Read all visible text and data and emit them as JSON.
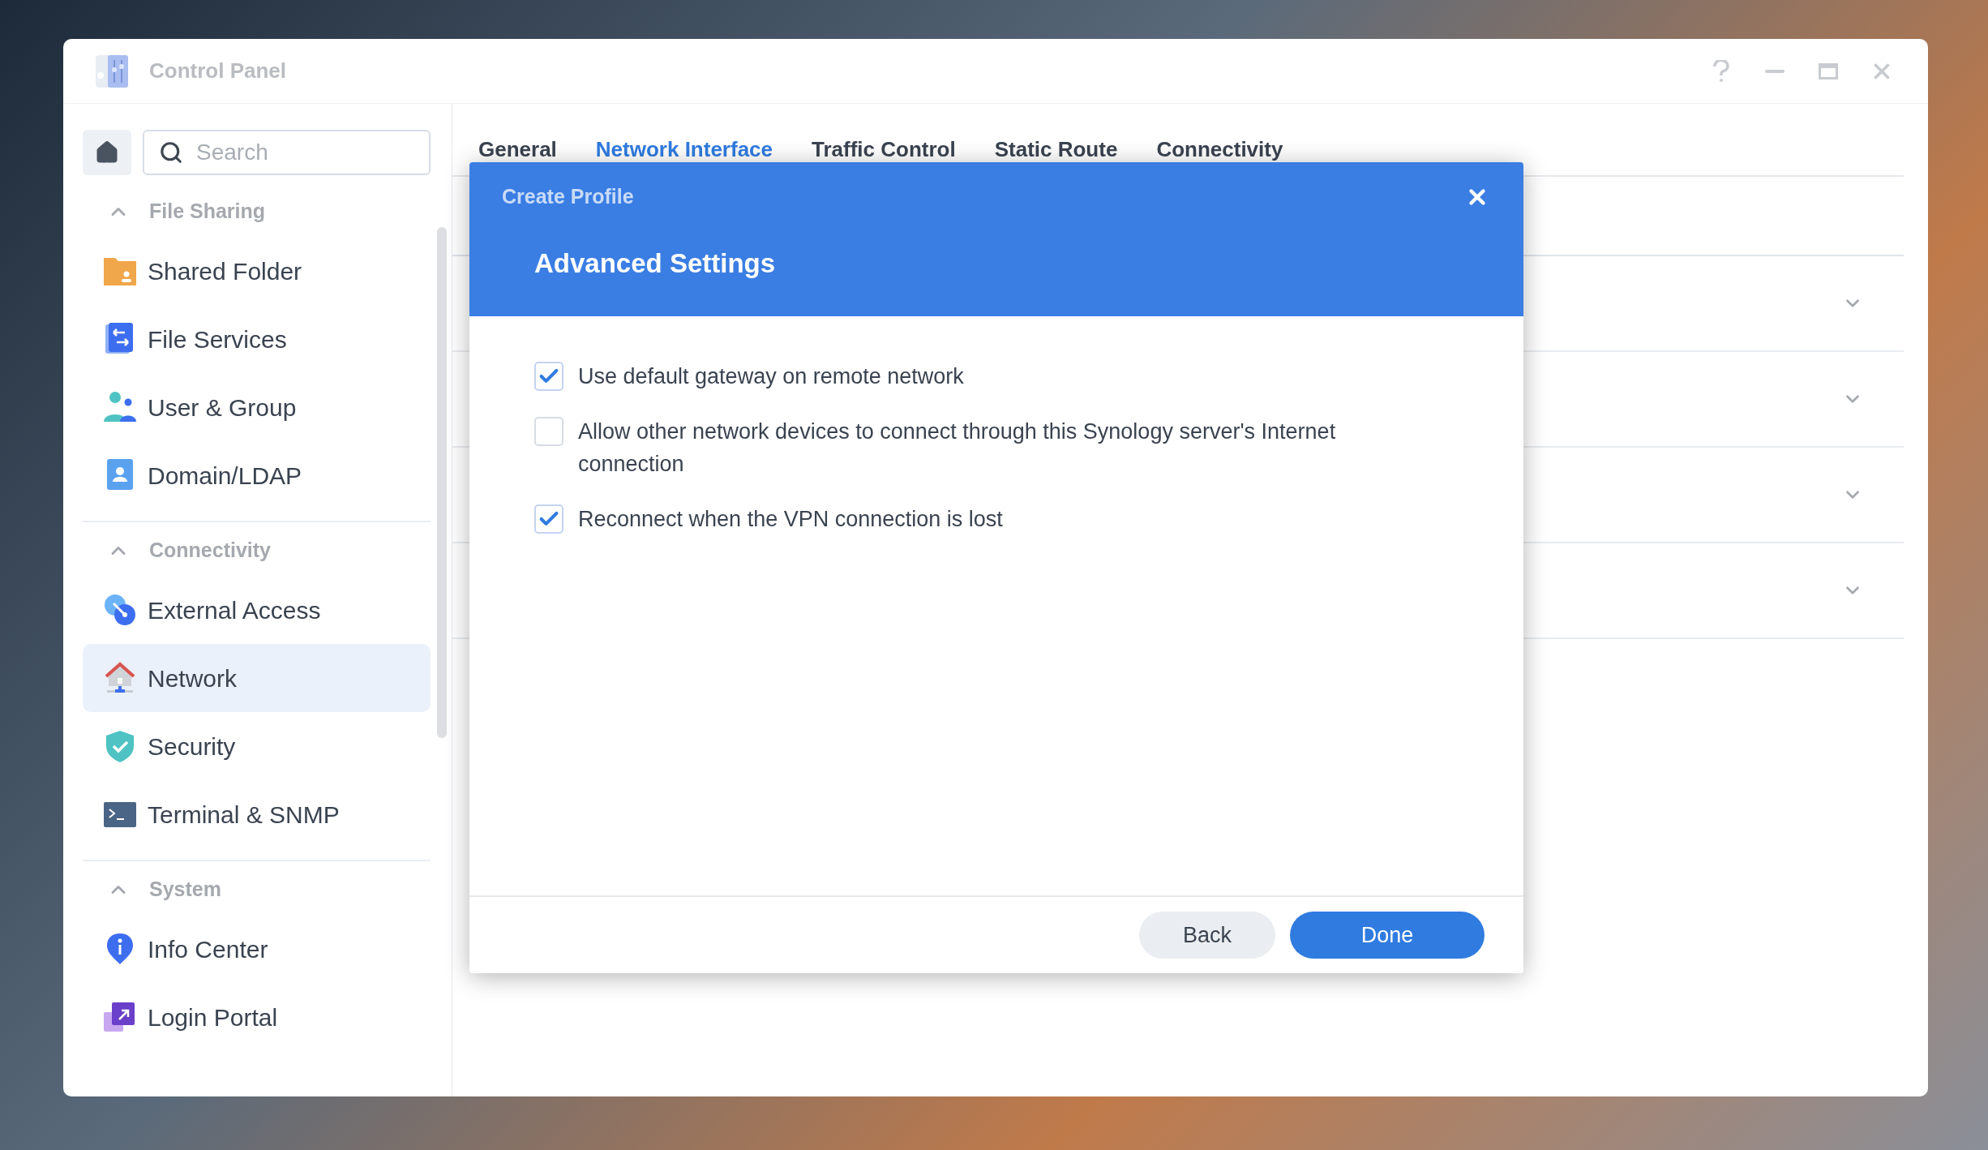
{
  "window": {
    "title": "Control Panel"
  },
  "search": {
    "placeholder": "Search"
  },
  "sidebar": {
    "sections": [
      {
        "title": "File Sharing",
        "expanded": true,
        "items": [
          {
            "label": "Shared Folder",
            "kind": "folder",
            "selected": false
          },
          {
            "label": "File Services",
            "kind": "transfer",
            "selected": false
          },
          {
            "label": "User & Group",
            "kind": "users",
            "selected": false
          },
          {
            "label": "Domain/LDAP",
            "kind": "contact",
            "selected": false
          }
        ]
      },
      {
        "title": "Connectivity",
        "expanded": true,
        "items": [
          {
            "label": "External Access",
            "kind": "access",
            "selected": false
          },
          {
            "label": "Network",
            "kind": "house",
            "selected": true
          },
          {
            "label": "Security",
            "kind": "shield",
            "selected": false
          },
          {
            "label": "Terminal & SNMP",
            "kind": "terminal",
            "selected": false
          }
        ]
      },
      {
        "title": "System",
        "expanded": true,
        "items": [
          {
            "label": "Info Center",
            "kind": "info",
            "selected": false
          },
          {
            "label": "Login Portal",
            "kind": "portal",
            "selected": false
          }
        ]
      }
    ]
  },
  "tabs": [
    {
      "label": "General",
      "selected": false
    },
    {
      "label": "Network Interface",
      "selected": true
    },
    {
      "label": "Traffic Control",
      "selected": false
    },
    {
      "label": "Static Route",
      "selected": false
    },
    {
      "label": "Connectivity",
      "selected": false
    }
  ],
  "interface_rows": [
    {
      "expanded": false
    },
    {
      "expanded": false
    },
    {
      "expanded": false
    },
    {
      "expanded": false
    }
  ],
  "dialog": {
    "title": "Create Profile",
    "heading": "Advanced Settings",
    "options": [
      {
        "label": "Use default gateway on remote network",
        "checked": true
      },
      {
        "label": "Allow other network devices to connect through this Synology server's Internet connection",
        "checked": false
      },
      {
        "label": "Reconnect when the VPN connection is lost",
        "checked": true
      }
    ],
    "buttons": [
      {
        "label": "Back",
        "kind": "secondary"
      },
      {
        "label": "Done",
        "kind": "primary"
      }
    ]
  }
}
